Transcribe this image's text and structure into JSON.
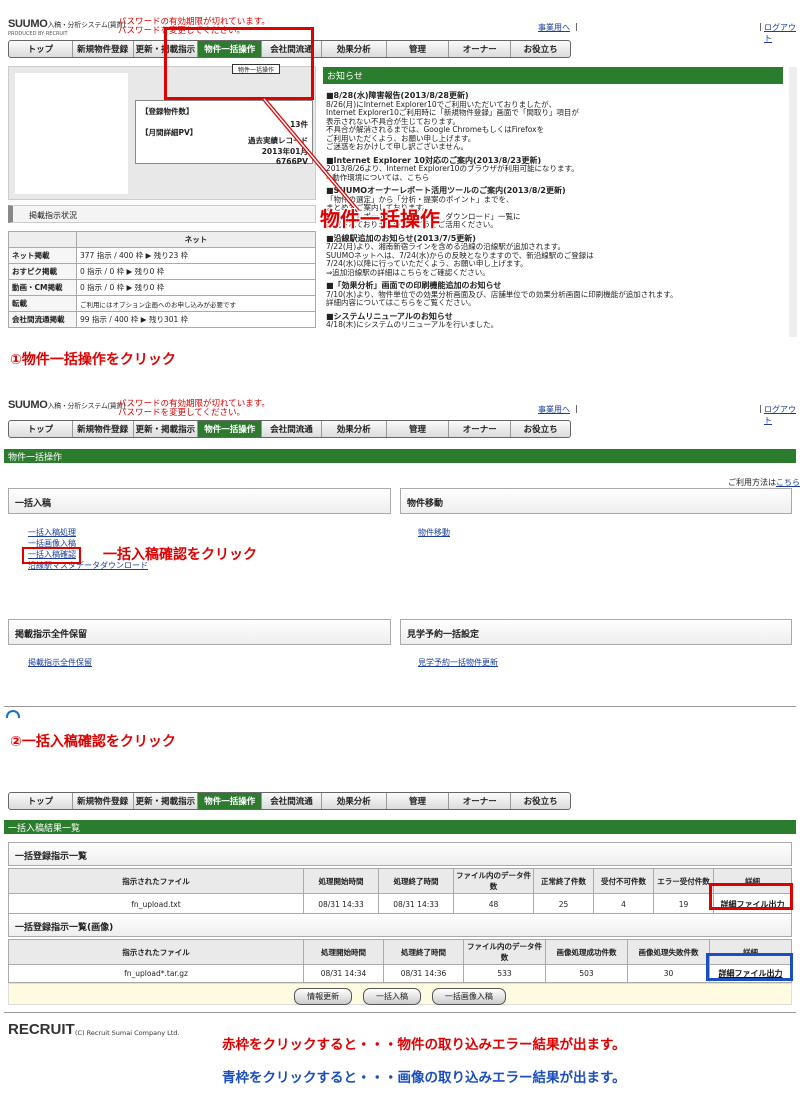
{
  "header": {
    "logo": "SUUMO",
    "logo_sub": "入稿・分析システム(賃貸)",
    "recruit_small": "PRODUCED BY RECRUIT",
    "pw_warning1": "パスワードの有効期限が切れています。",
    "pw_warning2": "パスワードを変更してください。",
    "office_link": "事業用へ",
    "separator": "|",
    "logout": "ログアウト"
  },
  "nav": {
    "items": [
      "トップ",
      "新規物件登録",
      "更新・掲載指示",
      "物件一括操作",
      "会社間流通",
      "効果分析",
      "管理",
      "オーナー",
      "お役立ち"
    ],
    "active": "物件一括操作"
  },
  "section1": {
    "tooltip": "物件一括操作",
    "summary_label1": "【登録物件数】",
    "summary_val1": "13件",
    "summary_label2": "【月間詳細PV】",
    "summary_note": "過去実績レコード",
    "summary_month": "2013年01月",
    "summary_pv": "6766PV",
    "status_header": "掲載指示状況",
    "status_col": "ネット",
    "status_rows": [
      {
        "label": "ネット掲載",
        "value": "377 指示 / 400 枠 ▶ 残り23 枠"
      },
      {
        "label": "おすピク掲載",
        "value": "0 指示 / 0 枠 ▶ 残り0 枠"
      },
      {
        "label": "動画・CM掲載",
        "value": "0 指示 / 0 枠 ▶ 残り0 枠"
      },
      {
        "label": "転載",
        "value": "ご利用にはオプション企画へのお申し込みが必要です"
      },
      {
        "label": "会社間流通掲載",
        "value": "99 指示 / 400 枠 ▶ 残り301 枠"
      }
    ],
    "news_title": "お知らせ",
    "news": [
      {
        "h": "■8/28(水)障害報告(2013/8/28更新)",
        "t": [
          "8/26(月)にInternet Explorer10でご利用いただいておりましたが、",
          "Internet Explorer10ご利用時に「新規物件登録」画面で「間取り」項目が",
          "表示されない不具合が生じております。",
          "不具合が解消されるまでは、Google ChromeもしくはFirefoxを",
          "ご利用いただくよう、お願い申し上げます。",
          "ご迷惑をおかけして申し訳ございません。"
        ]
      },
      {
        "h": "■Internet Explorer 10対応のご案内(2013/8/23更新)",
        "t": [
          "2013/8/26より、Internet Explorer10のブラウザが利用可能になります。",
          "⇒動作環境については、こちら"
        ]
      },
      {
        "h": "■SUUMOオーナーレポート活用ツールのご案内(2013/8/2更新)",
        "t": [
          "「物件の選定」から「分析・提案のポイント」までを、",
          "まとめてご案内しております。",
          "オーナーレポート、トップページ、ダウンロード」一覧に",
          "掲載されておりますので、どうぞご活用ください。"
        ]
      },
      {
        "h": "■沿線駅追加のお知らせ(2013/7/5更新)",
        "t": [
          "7/22(月)より、湘南新宿ラインを含める沿線の沿線駅が追加されます。",
          "SUUMOネットへは、7/24(水)からの反映となりますので、新沿線駅のご登録は",
          "7/24(水)以降に行っていただくよう、お願い申し上げます。",
          "⇒追加沿線駅の詳細はこちらをご確認ください。"
        ]
      },
      {
        "h": "■「効果分析」画面での印刷機能追加のお知らせ",
        "t": [
          "7/10(水)より、物件単位での効果分析画面及び、店舗単位での効果分析画面に印刷機能が追加されます。",
          "詳細内容についてはこちらをご覧ください。"
        ]
      },
      {
        "h": "■システムリニューアルのお知らせ",
        "t": [
          "4/18(木)にシステムのリニューアルを行いました。"
        ]
      }
    ],
    "big_label": "物件一括操作",
    "step_caption": "①物件一括操作をクリック"
  },
  "section2": {
    "page_title": "物件一括操作",
    "help_text": "ご利用方法は",
    "help_link": "こちら",
    "box1": "一括入稿",
    "box2": "物件移動",
    "box3": "掲載指示全件保留",
    "box4": "見学予約一括設定",
    "links1": [
      "一括入稿処理",
      "一括画像入稿",
      "一括入稿確認",
      "沿線駅マスタデータダウンロード"
    ],
    "link2": "物件移動",
    "link3": "掲載指示全件保留",
    "link4": "見学予約一括物件更新",
    "annot": "一括入稿確認をクリック",
    "step_caption": "②一括入稿確認をクリック"
  },
  "section3": {
    "page_title": "一括入稿結果一覧",
    "t1_title": "一括登録指示一覧",
    "t1_headers": [
      "指示されたファイル",
      "処理開始時間",
      "処理終了時間",
      "ファイル内のデータ件数",
      "正常終了件数",
      "受付不可件数",
      "エラー受付件数",
      "詳細"
    ],
    "t1_row": [
      "fn_upload.txt",
      "08/31 14:33",
      "08/31 14:33",
      "48",
      "25",
      "4",
      "19",
      "詳細ファイル出力"
    ],
    "t2_title": "一括登録指示一覧(画像)",
    "t2_headers": [
      "指示されたファイル",
      "処理開始時間",
      "処理終了時間",
      "ファイル内のデータ件数",
      "画像処理成功件数",
      "画像処理失敗件数",
      "詳細"
    ],
    "t2_row": [
      "fn_upload*.tar.gz",
      "08/31 14:34",
      "08/31 14:36",
      "533",
      "503",
      "30",
      "詳細ファイル出力"
    ],
    "buttons": [
      "情報更新",
      "一括入稿",
      "一括画像入稿"
    ],
    "footer_logo": "RECRUIT",
    "footer_copy": "(C) Recruit Sumai Company Ltd.",
    "note_red": "赤枠をクリックすると・・・物件の取り込みエラー結果が出ます。",
    "note_blue": "青枠をクリックすると・・・画像の取り込みエラー結果が出ます。"
  },
  "colors": {
    "green": "#2c7c2e",
    "red": "#e00000",
    "blue": "#1b4fbf"
  }
}
